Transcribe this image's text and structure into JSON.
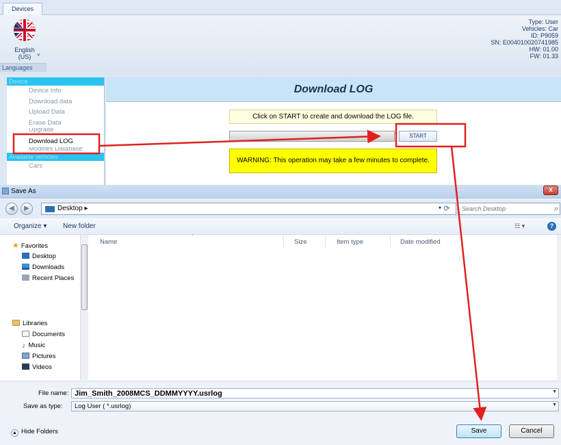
{
  "app": {
    "ribbon_tab": "Devices",
    "language": {
      "label": "English\n(US)",
      "dropdown": "˅",
      "group_label": "Languages"
    },
    "device_info": {
      "type": "Type: User",
      "vehicles": "Vehicles: Car",
      "id": "ID: P9059",
      "sn": "SN: E004010020741985",
      "hw": "HW: 01.00",
      "fw": "FW: 01.33"
    },
    "sidebar": {
      "device_header": "Device",
      "items": [
        "Device Info",
        "Download data",
        "Upload Data",
        "Erase Data",
        "Upgrade",
        "Download LOG",
        "Modifies Database"
      ],
      "vehicles_header": "Available vehicles",
      "vehicle_items": [
        "Cars"
      ]
    },
    "panel": {
      "title": "Download LOG",
      "instruction": "Click on START to create and download the LOG file.",
      "start_label": "START",
      "warning": "WARNING: This operation may take a few minutes to complete."
    }
  },
  "dialog": {
    "title": "Save As",
    "close": "x",
    "address": "Desktop",
    "address_sep": "▸",
    "search_placeholder": "Search Desktop",
    "toolbar": {
      "organize": "Organize ▾",
      "new_folder": "New folder"
    },
    "nav": {
      "favorites": "Favorites",
      "favorite_items": [
        "Desktop",
        "Downloads",
        "Recent Places"
      ],
      "libraries": "Libraries",
      "library_items": [
        "Documents",
        "Music",
        "Pictures",
        "Videos"
      ]
    },
    "columns": [
      "Name",
      "Size",
      "Item type",
      "Date modified"
    ],
    "file_name_label": "File name:",
    "file_name_value": "Jim_Smith_2008MCS_DDMMYYYY.usrlog",
    "save_type_label": "Save as type:",
    "save_type_value": "Log User ( *.usrlog)",
    "hide_folders": "Hide Folders",
    "save_label": "Save",
    "cancel_label": "Cancel"
  },
  "colors": {
    "sidebar_header": "#29c3f0",
    "panel_title_bg": "#c8e4f8",
    "warning_bg": "#ffff00",
    "instruction_bg": "#ffffe0",
    "annotation": "#e02020"
  }
}
